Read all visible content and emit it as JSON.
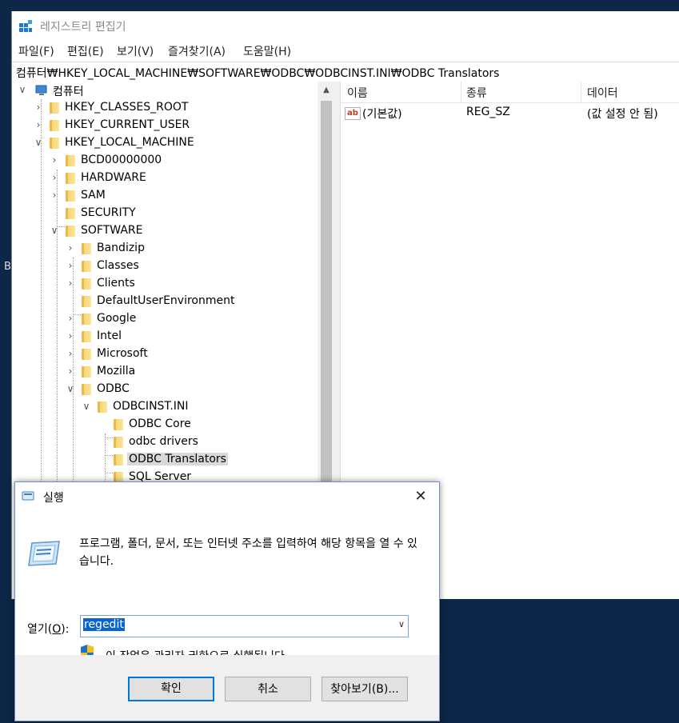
{
  "desktop": {
    "edge_glyph": "B"
  },
  "regedit": {
    "title": "레지스트리 편집기",
    "menu": [
      "파일(F)",
      "편집(E)",
      "보기(V)",
      "즐겨찾기(A)",
      "도움말(H)"
    ],
    "address": "컴퓨터₩HKEY_LOCAL_MACHINE₩SOFTWARE₩ODBC₩ODBCINST.INI₩ODBC Translators",
    "tree": {
      "root": "컴퓨터",
      "items": [
        {
          "label": "HKEY_CLASSES_ROOT",
          "expander": "collapsed"
        },
        {
          "label": "HKEY_CURRENT_USER",
          "expander": "collapsed"
        },
        {
          "label": "HKEY_LOCAL_MACHINE",
          "expander": "expanded"
        },
        {
          "label": "BCD00000000",
          "expander": "collapsed"
        },
        {
          "label": "HARDWARE",
          "expander": "collapsed"
        },
        {
          "label": "SAM",
          "expander": "collapsed"
        },
        {
          "label": "SECURITY",
          "expander": "none"
        },
        {
          "label": "SOFTWARE",
          "expander": "expanded"
        },
        {
          "label": "Bandizip",
          "expander": "collapsed"
        },
        {
          "label": "Classes",
          "expander": "collapsed"
        },
        {
          "label": "Clients",
          "expander": "collapsed"
        },
        {
          "label": "DefaultUserEnvironment",
          "expander": "none"
        },
        {
          "label": "Google",
          "expander": "collapsed"
        },
        {
          "label": "Intel",
          "expander": "collapsed"
        },
        {
          "label": "Microsoft",
          "expander": "collapsed"
        },
        {
          "label": "Mozilla",
          "expander": "collapsed"
        },
        {
          "label": "ODBC",
          "expander": "expanded"
        },
        {
          "label": "ODBCINST.INI",
          "expander": "expanded"
        },
        {
          "label": "ODBC Core",
          "expander": "none"
        },
        {
          "label": "odbc drivers",
          "expander": "none"
        },
        {
          "label": "ODBC Translators",
          "expander": "none",
          "selected": true
        },
        {
          "label": "SQL Server",
          "expander": "none"
        }
      ]
    },
    "list": {
      "columns": [
        "이름",
        "종류",
        "데이터"
      ],
      "rows": [
        {
          "name": "(기본값)",
          "type": "REG_SZ",
          "data": "(값 설정 안 됨)",
          "icon": "ab-string-icon"
        }
      ]
    }
  },
  "run_dialog": {
    "title": "실행",
    "description": "프로그램, 폴더, 문서, 또는 인터넷 주소를 입력하여 해당 항목을 열 수 있습니다.",
    "open_label_prefix": "열기(",
    "open_label_key": "O",
    "open_label_suffix": "):",
    "input_value": "regedit",
    "admin_note": "이 작업은 관리자 권한으로 실행됩니다.",
    "buttons": {
      "ok": "확인",
      "cancel": "취소",
      "browse": "찾아보기(B)..."
    }
  },
  "colors": {
    "desktop": "#0c2747",
    "accent": "#0078d7",
    "selection": "#0a64d0"
  }
}
